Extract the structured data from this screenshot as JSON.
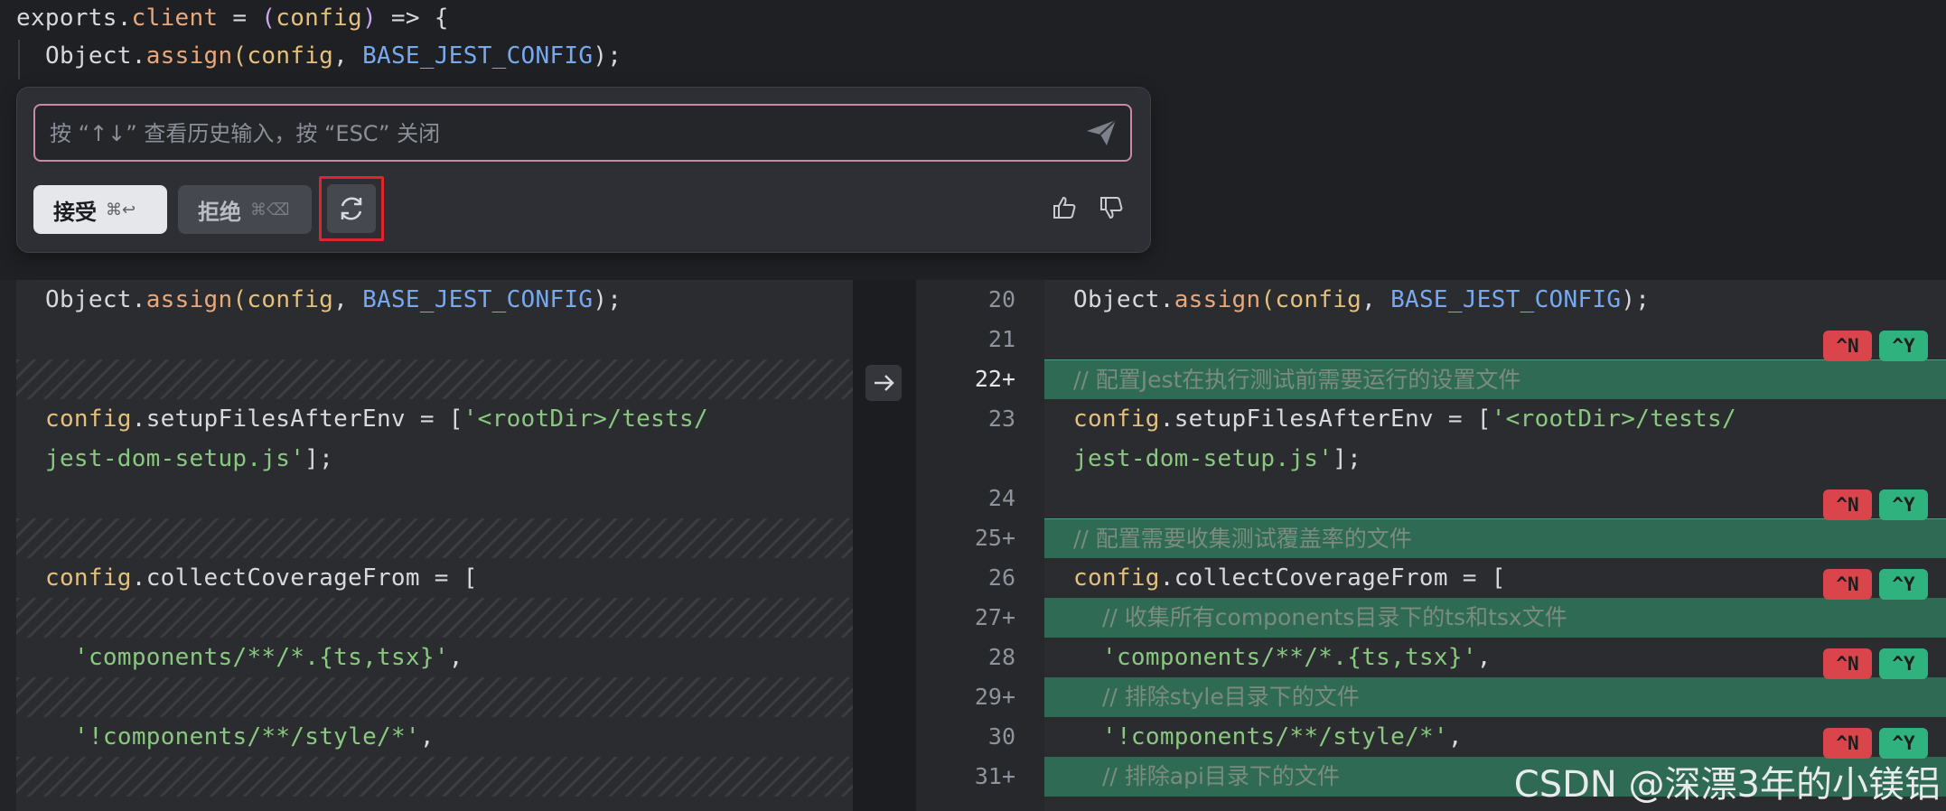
{
  "top_code": {
    "line1": {
      "obj": "exports",
      "dot": ".",
      "prop": "client",
      "eq": " = ",
      "lp": "(",
      "arg": "config",
      "rp": ")",
      "arrow": " => {"
    },
    "line2": {
      "obj": "Object",
      "dot": ".",
      "fn": "assign",
      "lp": "(",
      "arg": "config",
      "comma": ", ",
      "const": "BASE_JEST_CONFIG",
      "rp": ");"
    }
  },
  "prompt": {
    "placeholder": "按 “↑↓” 查看历史输入，按 “ESC” 关闭",
    "accept_label": "接受",
    "accept_shortcut": "⌘↩",
    "reject_label": "拒绝",
    "reject_shortcut": "⌘⌫"
  },
  "left_diff": {
    "l1": {
      "obj": "Object",
      "dot": ".",
      "fn": "assign",
      "lp": "(",
      "arg": "config",
      "comma": ", ",
      "const": "BASE_JEST_CONFIG",
      "rp": ");"
    },
    "l2a": {
      "obj": "config",
      "dot": ".",
      "prop": "setupFilesAfterEnv",
      "eq": " = [",
      "str": "'<rootDir>/tests/"
    },
    "l2b": {
      "str": "jest-dom-setup.js'",
      "end": "];"
    },
    "l3": {
      "obj": "config",
      "dot": ".",
      "prop": "collectCoverageFrom",
      "eq": " = ["
    },
    "l4": {
      "str": "'components/**/*.{ts,tsx}'",
      "end": ","
    },
    "l5": {
      "str": "'!components/**/style/*'",
      "end": ","
    }
  },
  "right_diff": {
    "line_numbers": [
      "20",
      "21",
      "22+",
      "23",
      "",
      "24",
      "25+",
      "26",
      "27+",
      "28",
      "29+",
      "30",
      "31+"
    ],
    "c20": {
      "obj": "Object",
      "dot": ".",
      "fn": "assign",
      "lp": "(",
      "arg": "config",
      "comma": ", ",
      "const": "BASE_JEST_CONFIG",
      "rp": ");"
    },
    "c22": "// 配置Jest在执行测试前需要运行的设置文件",
    "c23a": {
      "obj": "config",
      "dot": ".",
      "prop": "setupFilesAfterEnv",
      "eq": " = [",
      "str": "'<rootDir>/tests/"
    },
    "c23b": {
      "str": "jest-dom-setup.js'",
      "end": "];"
    },
    "c25": "// 配置需要收集测试覆盖率的文件",
    "c26": {
      "obj": "config",
      "dot": ".",
      "prop": "collectCoverageFrom",
      "eq": " = ["
    },
    "c27": "// 收集所有components目录下的ts和tsx文件",
    "c28": {
      "str": "'components/**/*.{ts,tsx}'",
      "end": ","
    },
    "c29": "// 排除style目录下的文件",
    "c30": {
      "str": "'!components/**/style/*'",
      "end": ","
    },
    "c31": "// 排除api目录下的文件",
    "badge_reject": "^N",
    "badge_accept": "^Y"
  },
  "watermark": "CSDN @深漂3年的小镁铝",
  "colors": {
    "accent_border": "#c98aa5",
    "added_bg": "#2f6b54",
    "reject_badge": "#d9454b",
    "accept_badge": "#2fb27e",
    "highlight_box": "#e0242b"
  }
}
